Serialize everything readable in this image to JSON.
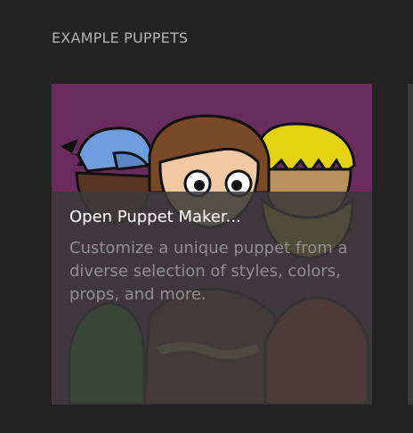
{
  "section": {
    "title": "EXAMPLE PUPPETS"
  },
  "card": {
    "title": "Open Puppet Maker...",
    "description": "Customize a unique puppet from a diverse selection of styles, colors, props, and more."
  },
  "colors": {
    "background": "#232323",
    "card_background": "#6a2c5e",
    "overlay": "#3a3a3a",
    "title_text": "#ffffff",
    "description_text": "#8f8f8f"
  }
}
